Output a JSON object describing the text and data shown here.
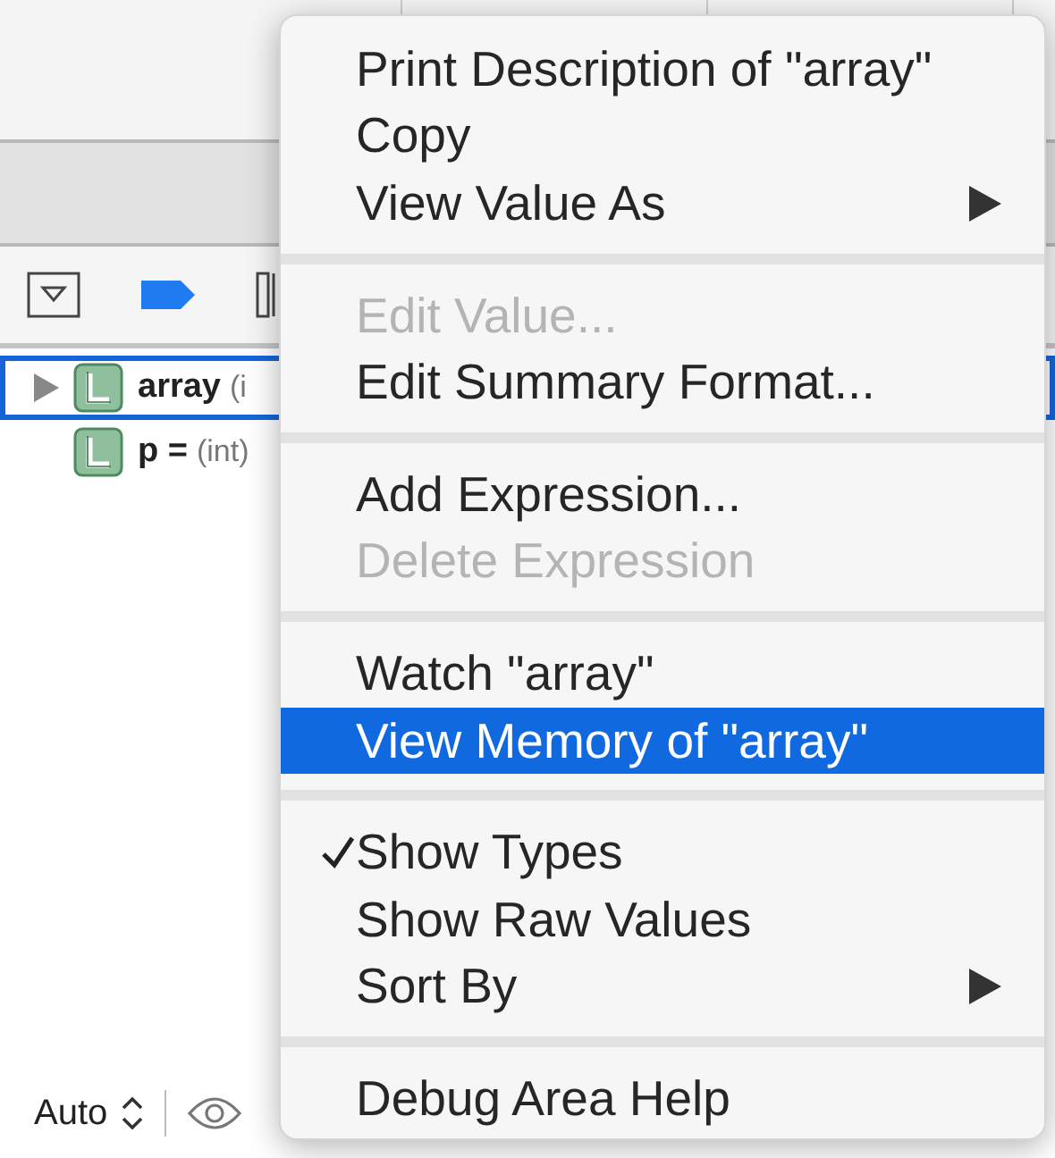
{
  "variables": [
    {
      "name": "array",
      "type": "(i",
      "expanded": false,
      "selected": true,
      "expandable": true
    },
    {
      "name": "p =",
      "type": "(int)",
      "selected": false,
      "expandable": false
    }
  ],
  "bottom_bar": {
    "scope": "Auto"
  },
  "context_menu": {
    "sections": [
      [
        {
          "label": "Print Description of \"array\"",
          "disabled": false,
          "selected": false,
          "checked": false,
          "submenu": false
        },
        {
          "label": "Copy",
          "disabled": false,
          "selected": false,
          "checked": false,
          "submenu": false
        },
        {
          "label": "View Value As",
          "disabled": false,
          "selected": false,
          "checked": false,
          "submenu": true
        }
      ],
      [
        {
          "label": "Edit Value...",
          "disabled": true,
          "selected": false,
          "checked": false,
          "submenu": false
        },
        {
          "label": "Edit Summary Format...",
          "disabled": false,
          "selected": false,
          "checked": false,
          "submenu": false
        }
      ],
      [
        {
          "label": "Add Expression...",
          "disabled": false,
          "selected": false,
          "checked": false,
          "submenu": false
        },
        {
          "label": "Delete Expression",
          "disabled": true,
          "selected": false,
          "checked": false,
          "submenu": false
        }
      ],
      [
        {
          "label": "Watch \"array\"",
          "disabled": false,
          "selected": false,
          "checked": false,
          "submenu": false
        },
        {
          "label": "View Memory of \"array\"",
          "disabled": false,
          "selected": true,
          "checked": false,
          "submenu": false
        }
      ],
      [
        {
          "label": "Show Types",
          "disabled": false,
          "selected": false,
          "checked": true,
          "submenu": false
        },
        {
          "label": "Show Raw Values",
          "disabled": false,
          "selected": false,
          "checked": false,
          "submenu": false
        },
        {
          "label": "Sort By",
          "disabled": false,
          "selected": false,
          "checked": false,
          "submenu": true
        }
      ],
      [
        {
          "label": "Debug Area Help",
          "disabled": false,
          "selected": false,
          "checked": false,
          "submenu": false
        }
      ]
    ]
  }
}
